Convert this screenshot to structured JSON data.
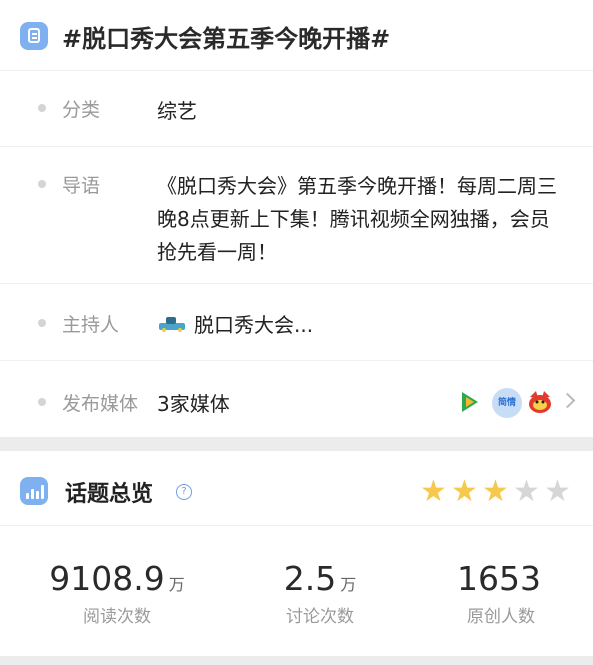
{
  "topic": {
    "title": "#脱口秀大会第五季今晚开播#",
    "icon": "document-icon"
  },
  "details": {
    "category": {
      "label": "分类",
      "value": "综艺"
    },
    "guide": {
      "label": "导语",
      "value": "《脱口秀大会》第五季今晚开播！每周二周三晚8点更新上下集！腾讯视频全网独播，会员抢先看一周！"
    },
    "host": {
      "label": "主持人",
      "value": "脱口秀大会..."
    },
    "media": {
      "label": "发布媒体",
      "value": "3家媒体",
      "logos": [
        "tencent-video-logo",
        "news-circle-logo",
        "mascot-logo"
      ],
      "logo_text": "简情"
    }
  },
  "overview": {
    "title": "话题总览",
    "rating": 3,
    "rating_max": 5,
    "star_color_on": "#f6c84c",
    "star_color_off": "#d6d6d6",
    "stats": [
      {
        "value": "9108.9",
        "unit": "万",
        "label": "阅读次数"
      },
      {
        "value": "2.5",
        "unit": "万",
        "label": "讨论次数"
      },
      {
        "value": "1653",
        "unit": "",
        "label": "原创人数"
      }
    ]
  },
  "colors": {
    "accent": "#7fb0ef",
    "label_gray": "#9a9a9a",
    "background": "#ececec"
  }
}
